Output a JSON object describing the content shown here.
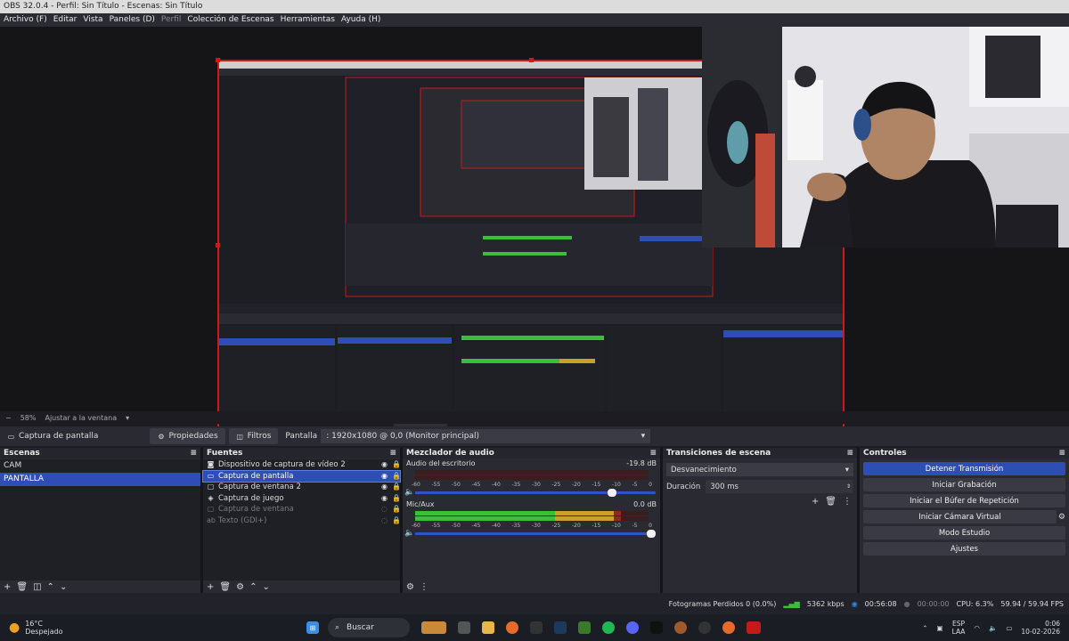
{
  "window": {
    "title": "OBS 32.0.4 - Perfil: Sin Título - Escenas: Sin Título"
  },
  "menu": [
    {
      "label": "Archivo (F)",
      "enabled": true
    },
    {
      "label": "Editar",
      "enabled": true
    },
    {
      "label": "Vista",
      "enabled": true
    },
    {
      "label": "Paneles (D)",
      "enabled": true
    },
    {
      "label": "Perfil",
      "enabled": false
    },
    {
      "label": "Colección de Escenas",
      "enabled": true
    },
    {
      "label": "Herramientas",
      "enabled": true
    },
    {
      "label": "Ayuda (H)",
      "enabled": true
    }
  ],
  "zoom": {
    "minus": "−",
    "value": "58%",
    "fit_label": "Ajustar a la ventana",
    "dropdown": "▾"
  },
  "toolbar": {
    "source_name": "Captura de pantalla",
    "properties_label": "Propiedades",
    "filters_label": "Filtros",
    "display_label": "Pantalla",
    "display_value": ": 1920x1080 @ 0,0 (Monitor principal)"
  },
  "scenes": {
    "title": "Escenas",
    "items": [
      {
        "label": "CAM",
        "selected": false
      },
      {
        "label": "PANTALLA",
        "selected": true
      }
    ]
  },
  "sources": {
    "title": "Fuentes",
    "items": [
      {
        "label": "Dispositivo de captura de vídeo 2",
        "icon": "camera-icon",
        "visible": true,
        "selected": false
      },
      {
        "label": "Captura de pantalla",
        "icon": "monitor-icon",
        "visible": true,
        "selected": true
      },
      {
        "label": "Captura de ventana 2",
        "icon": "window-icon",
        "visible": true,
        "selected": false
      },
      {
        "label": "Captura de juego",
        "icon": "gamepad-icon",
        "visible": true,
        "selected": false
      },
      {
        "label": "Captura de ventana",
        "icon": "window-icon",
        "visible": false,
        "selected": false
      },
      {
        "label": "Texto (GDI+)",
        "icon": "text-icon",
        "visible": false,
        "selected": false
      }
    ]
  },
  "mixer": {
    "title": "Mezclador de audio",
    "scale": [
      "-60",
      "-55",
      "-50",
      "-45",
      "-40",
      "-35",
      "-30",
      "-25",
      "-20",
      "-15",
      "-10",
      "-5",
      "0"
    ],
    "channels": [
      {
        "name": "Audio del escritorio",
        "db": "-19.8 dB",
        "level": 0.0,
        "volume": 0.83
      },
      {
        "name": "Mic/Aux",
        "db": "0.0 dB",
        "level": 0.88,
        "volume": 1.0
      }
    ]
  },
  "transitions": {
    "title": "Transiciones de escena",
    "selected": "Desvanecimiento",
    "duration_label": "Duración",
    "duration_value": "300 ms"
  },
  "controls": {
    "title": "Controles",
    "buttons": [
      "Detener Transmisión",
      "Iniciar Grabación",
      "Iniciar el Búfer de Repetición",
      "Iniciar Cámara Virtual",
      "Modo Estudio",
      "Ajustes"
    ]
  },
  "status": {
    "dropped": "Fotogramas Perdidos 0 (0.0%)",
    "bitrate": "5362 kbps",
    "live_time": "00:56:08",
    "rec_time": "00:00:00",
    "cpu": "CPU: 6.3%",
    "fps": "59.94 / 59.94 FPS"
  },
  "taskbar": {
    "temp": "16°C",
    "weather": "Despejado",
    "search": "Buscar",
    "lang_top": "ESP",
    "lang_bottom": "LAA",
    "time": "0:06",
    "date": "10-02-2026"
  },
  "colors": {
    "accent": "#2e4db5",
    "selection_border": "#d01818",
    "meter_green": "#3bbf3b",
    "meter_yellow": "#c9a02a",
    "meter_red": "#8c2a2a"
  }
}
